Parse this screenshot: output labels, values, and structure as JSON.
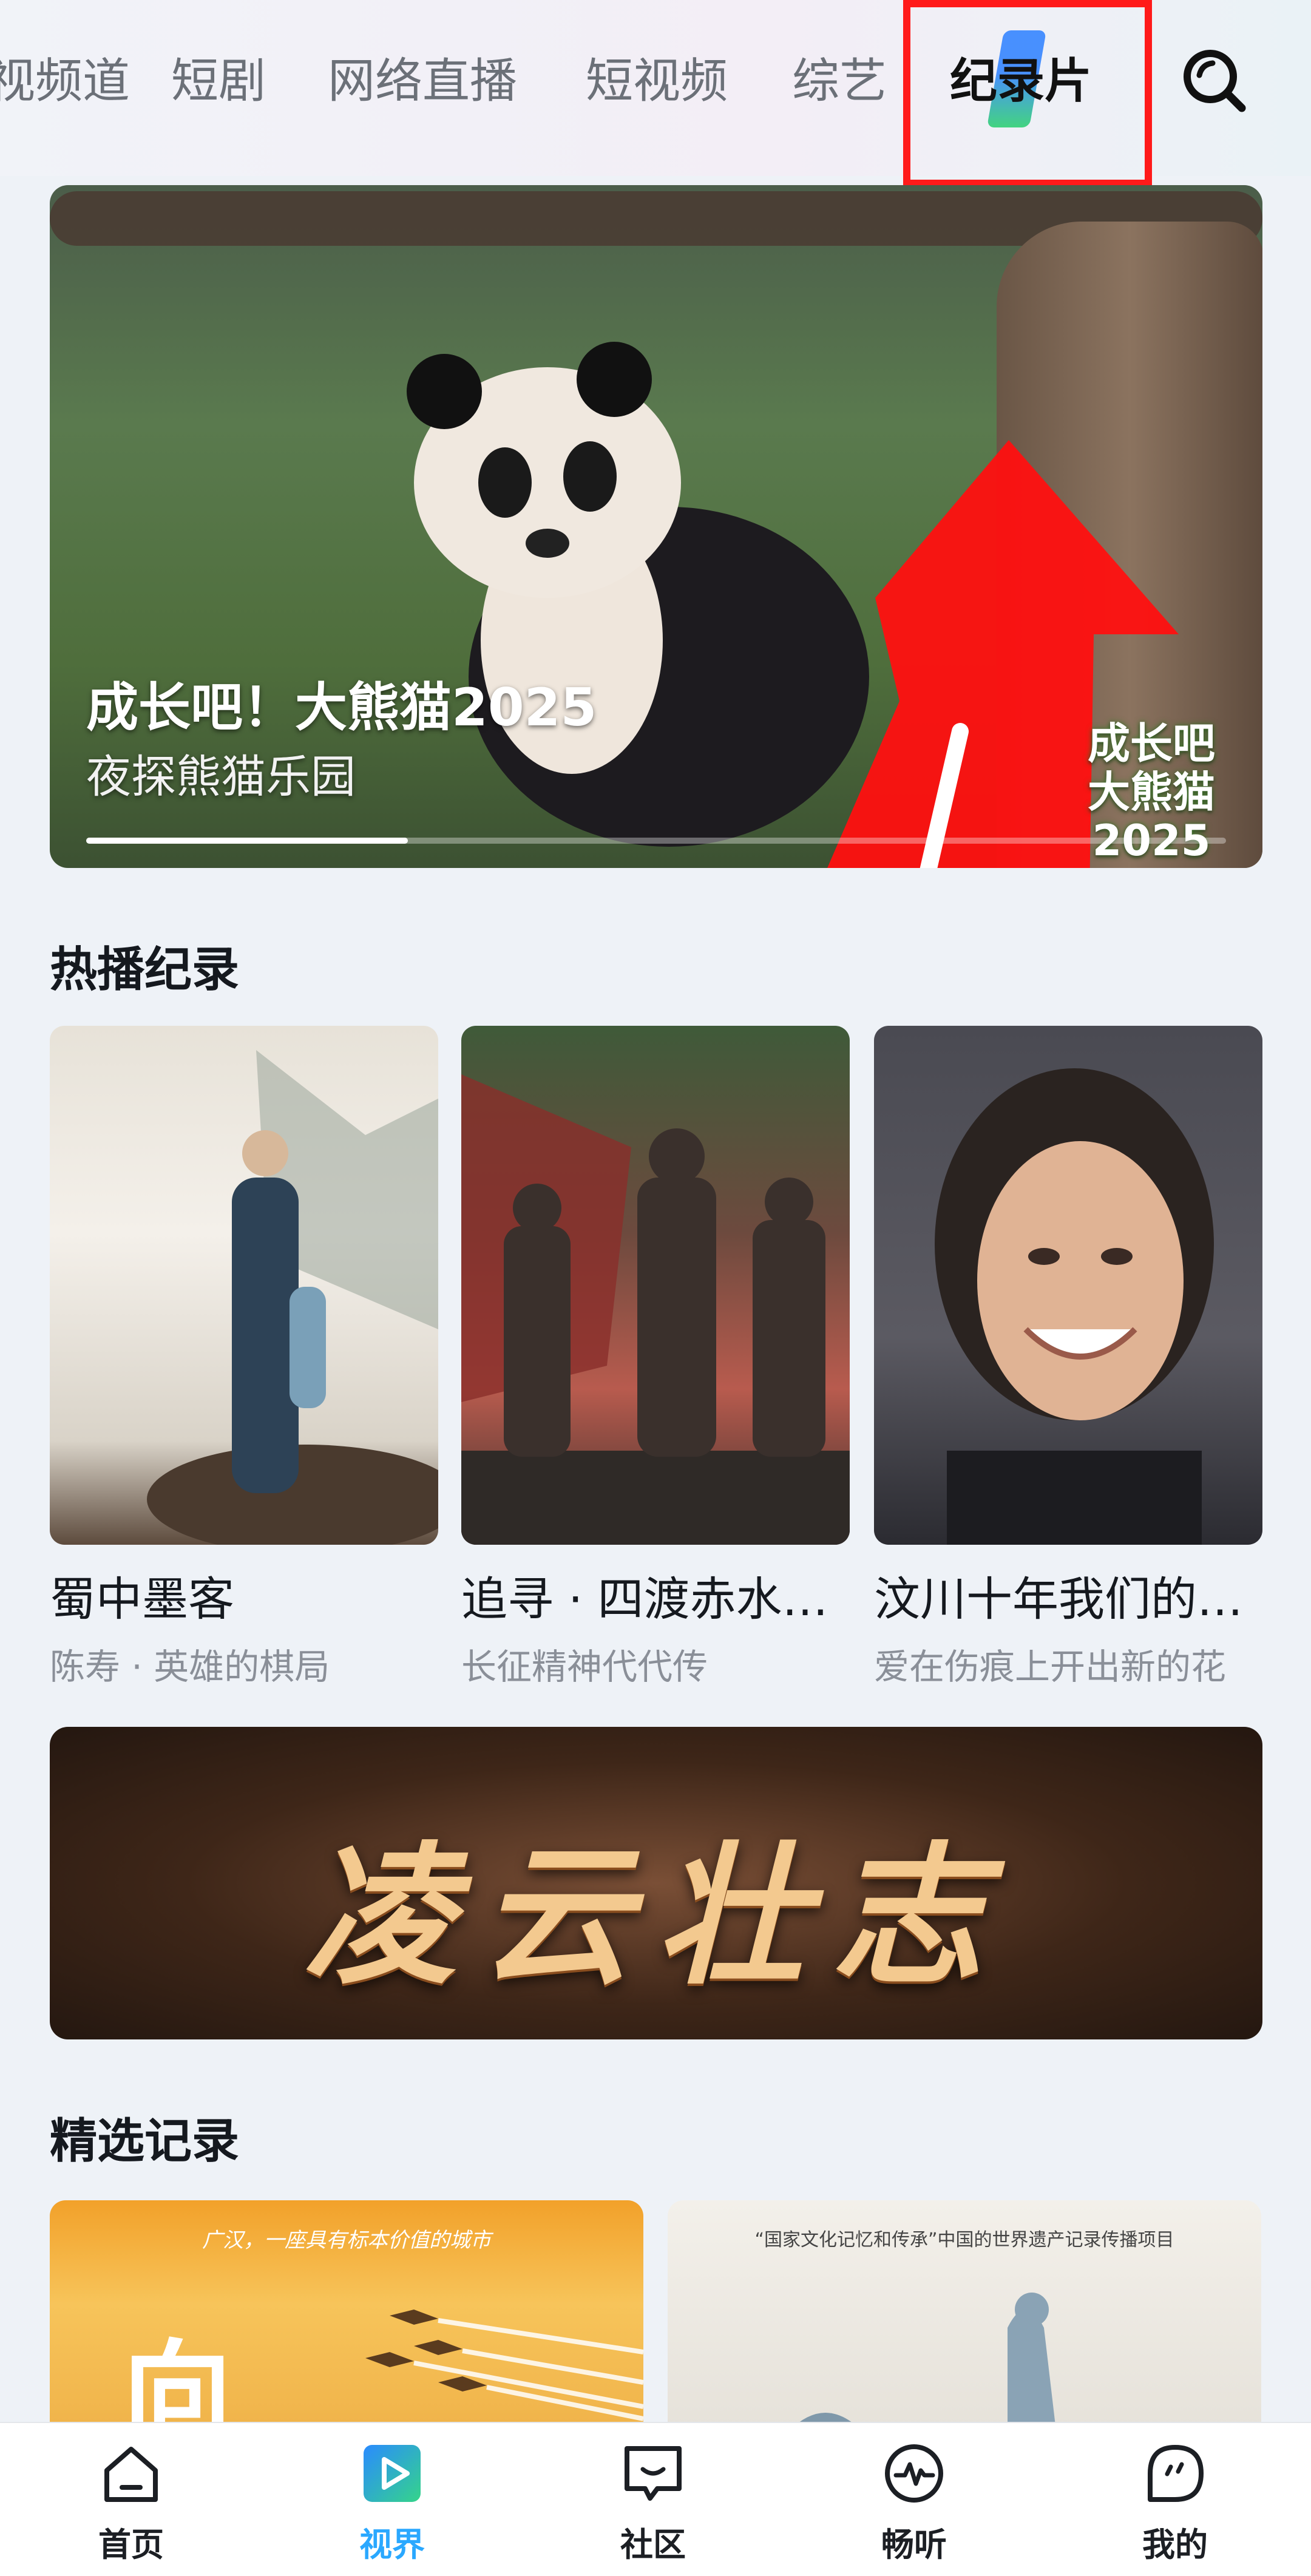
{
  "top_tabs": {
    "items": [
      "视频道",
      "短剧",
      "网络直播",
      "短视频",
      "综艺",
      "纪录片"
    ],
    "active_index": 5,
    "search_icon": "search-icon"
  },
  "banner": {
    "title": "成长吧！大熊猫2025",
    "subtitle": "夜探熊猫乐园",
    "logo_text": "成长吧\n大熊猫\n2025"
  },
  "hot_section": {
    "title": "热播纪录",
    "cards": [
      {
        "title": "蜀中墨客",
        "subtitle": "陈寿 · 英雄的棋局"
      },
      {
        "title": "追寻 · 四渡赤水…",
        "subtitle": "长征精神代代传"
      },
      {
        "title": "汶川十年我们的…",
        "subtitle": "爱在伤痕上开出新的花"
      }
    ]
  },
  "feature_banner": {
    "text": "凌云壮志"
  },
  "selected_section": {
    "title": "精选记录",
    "cards": [
      {
        "caption": "广汉，一座具有标本价值的城市",
        "big_char": "向"
      },
      {
        "caption": "“国家文化记忆和传承”中国的世界遗产记录传播项目"
      }
    ]
  },
  "bottom_nav": {
    "items": [
      {
        "label": "首页",
        "icon": "home-icon"
      },
      {
        "label": "视界",
        "icon": "play-icon"
      },
      {
        "label": "社区",
        "icon": "chat-icon"
      },
      {
        "label": "畅听",
        "icon": "audio-icon"
      },
      {
        "label": "我的",
        "icon": "profile-icon"
      }
    ],
    "active_index": 1,
    "active_color": "#2aa8ff"
  },
  "annotation": {
    "box_color": "#ff1a1a",
    "arrow_color": "#ff1010"
  }
}
